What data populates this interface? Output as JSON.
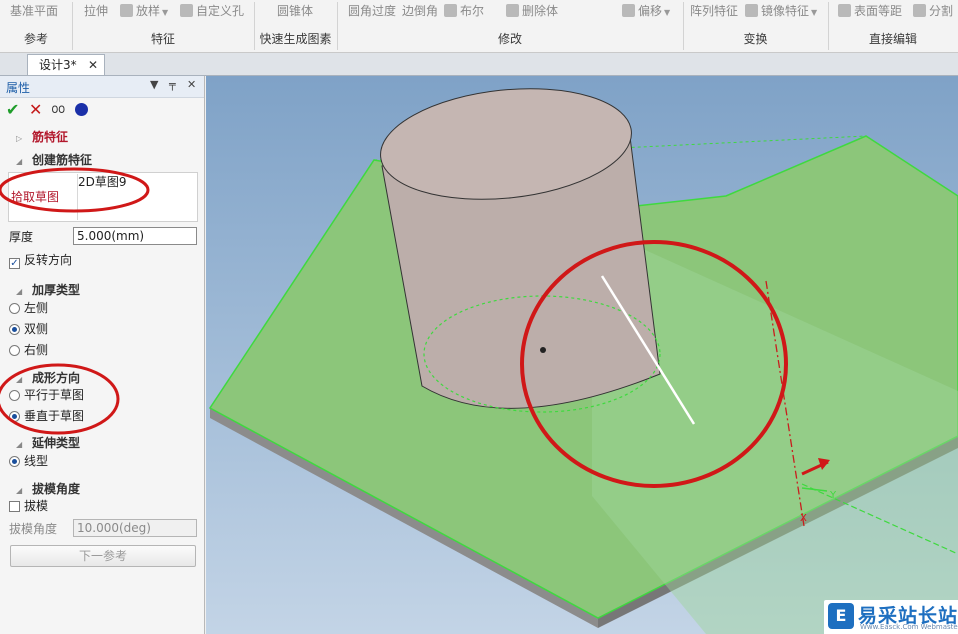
{
  "ribbon": {
    "top_items": [
      "基准平面",
      "拉伸",
      "放样",
      "自定义孔",
      "圆锥体",
      "圆角过度",
      "边倒角",
      "布尔",
      "删除体",
      "偏移",
      "阵列特征",
      "镜像特征",
      "表面等距",
      "分割"
    ],
    "groups": [
      "参考",
      "特征",
      "快速生成图素",
      "修改",
      "变换",
      "直接编辑"
    ]
  },
  "tab": {
    "label": "设计3*",
    "close": "✕"
  },
  "panel": {
    "title": "属性",
    "section_rib": "筋特征",
    "section_create": "创建筋特征",
    "pick_sketch_label": "拾取草图",
    "sketch_value": "2D草图9",
    "thickness_label": "厚度",
    "thickness_value": "5.000(mm)",
    "reverse_label": "反转方向",
    "thicken_type_label": "加厚类型",
    "opt_left": "左侧",
    "opt_both": "双侧",
    "opt_right": "右侧",
    "form_dir_label": "成形方向",
    "opt_parallel": "平行于草图",
    "opt_perpendicular": "垂直于草图",
    "extend_type_label": "延伸类型",
    "opt_linear": "线型",
    "draft_angle_section": "拔模角度",
    "draft_check_label": "拔模",
    "draft_angle_label": "拔模角度",
    "draft_angle_value": "10.000(deg)",
    "next_ref_button": "下一参考"
  },
  "viewport": {
    "axis_x": "X",
    "axis_y": "Y",
    "plate_color": "#8cc67a",
    "cylinder_color": "#bcaeaa",
    "annotation_color": "#d01818"
  },
  "watermark": {
    "text": "易采站长站",
    "sub": "Www.Easck.Com  Webmaster"
  }
}
